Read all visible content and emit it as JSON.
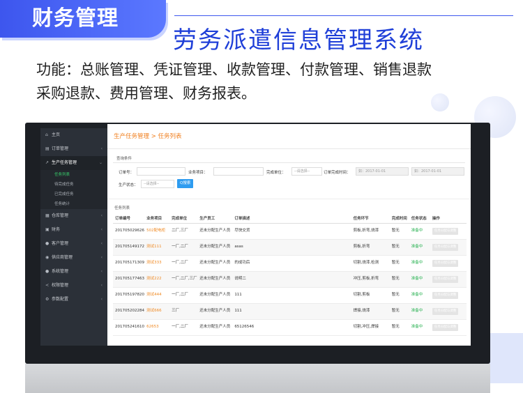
{
  "banner": {
    "badge": "财务管理",
    "headline": "劳务派遣信息管理系统",
    "line1": "功能：总账管理、凭证管理、收款管理、付款管理、销售退款",
    "line2": "采购退款、费用管理、财务报表。"
  },
  "sidebar": {
    "items": [
      {
        "icon": "⌂",
        "label": "主页",
        "arrow": ""
      },
      {
        "icon": "▤",
        "label": "订单管理",
        "arrow": "‹"
      },
      {
        "icon": "↗",
        "label": "生产任务管理",
        "arrow": "⌄"
      },
      {
        "icon": "▦",
        "label": "仓库管理",
        "arrow": "‹"
      },
      {
        "icon": "▣",
        "label": "财务",
        "arrow": "‹"
      },
      {
        "icon": "●",
        "label": "客户管理",
        "arrow": "‹"
      },
      {
        "icon": "◉",
        "label": "供应商管理",
        "arrow": "‹"
      },
      {
        "icon": "●",
        "label": "系统管理",
        "arrow": "‹"
      },
      {
        "icon": "≺",
        "label": "权限管理",
        "arrow": "‹"
      },
      {
        "icon": "⚙",
        "label": "参数配置",
        "arrow": "‹"
      }
    ],
    "subitems": [
      "任务列表",
      "待完成任务",
      "已完成任务",
      "任务统计"
    ]
  },
  "content": {
    "breadcrumb": "生产任务管理 > 任务列表",
    "query_label": "查询条件",
    "filters": {
      "order_no": "订单号：",
      "business": "业务项目：",
      "unit": "完成单位：",
      "unit_select": "--请选择--",
      "deadline": "订单完成时间：",
      "date_from": "如：2017-01-01",
      "date_to": "如：2017-01-01",
      "status": "生产状态：",
      "status_select": "--请选择--",
      "search_btn": "Q搜索"
    },
    "list_label": "任务列表",
    "columns": [
      "订单编号",
      "业务项目",
      "完成单位",
      "生产员工",
      "订单描述",
      "任务环节",
      "完成时间",
      "任务状态",
      "操作"
    ],
    "rows": [
      [
        "201705029626",
        "502配电柜",
        "二厂,三厂",
        "还未分配生产人员",
        "尽快交货",
        "剪板,折弯,烧漆",
        "暂无",
        "准备中",
        "任务分配与调整"
      ],
      [
        "201705149172",
        "测试111",
        "一厂,二厂",
        "还未分配生产人员",
        "asas",
        "剪板,折弯",
        "暂无",
        "准备中",
        "任务分配与调整"
      ],
      [
        "201705171309",
        "测试333",
        "一厂,二厂",
        "还未分配生产人员",
        "的成功后",
        "切割,烧漆,检测",
        "暂无",
        "准备中",
        "任务分配与调整"
      ],
      [
        "201705177463",
        "测试222",
        "一厂,二厂,三厂",
        "还未分配生产人员",
        "说明二",
        "冲压,剪板,折弯",
        "暂无",
        "准备中",
        "任务分配与调整"
      ],
      [
        "201705197820",
        "测试444",
        "一厂,二厂",
        "还未分配生产人员",
        "111",
        "切割,剪板",
        "暂无",
        "准备中",
        "任务分配与调整"
      ],
      [
        "201705202284",
        "测试666",
        "三厂",
        "还未分配生产人员",
        "111",
        "焊接,烧漆",
        "暂无",
        "准备中",
        "任务分配与调整"
      ],
      [
        "201705241610",
        "62653",
        "一厂,二厂",
        "还未分配生产人员",
        "65126546",
        "切割,冲压,焊接",
        "暂无",
        "准备中",
        "任务分配与调整"
      ]
    ]
  }
}
